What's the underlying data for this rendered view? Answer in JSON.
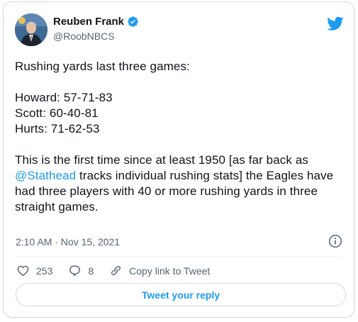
{
  "author": {
    "display_name": "Reuben Frank",
    "handle": "@RoobNBCS",
    "verified": true,
    "avatar_icon": "profile-photo"
  },
  "brand_icon": "twitter-bird-icon",
  "tweet": {
    "lines": [
      "Rushing yards last three games:",
      "",
      "Howard: 57-71-83",
      "Scott: 60-40-81",
      "Hurts: 71-62-53",
      ""
    ],
    "para_before_mention": "This is the first time since at least 1950 [as far back as ",
    "mention": "@Stathead",
    "para_after_mention": " tracks individual rushing stats] the Eagles have had three players with 40 or more rushing yards in three straight games."
  },
  "timestamp": "2:10 AM · Nov 15, 2021",
  "actions": {
    "like_count": "253",
    "reply_count": "8",
    "copy_link_label": "Copy link to Tweet"
  },
  "reply_button_label": "Tweet your reply",
  "colors": {
    "accent": "#1d9bf0",
    "text": "#0f1419",
    "secondary": "#536471",
    "border": "#cfd9de"
  }
}
